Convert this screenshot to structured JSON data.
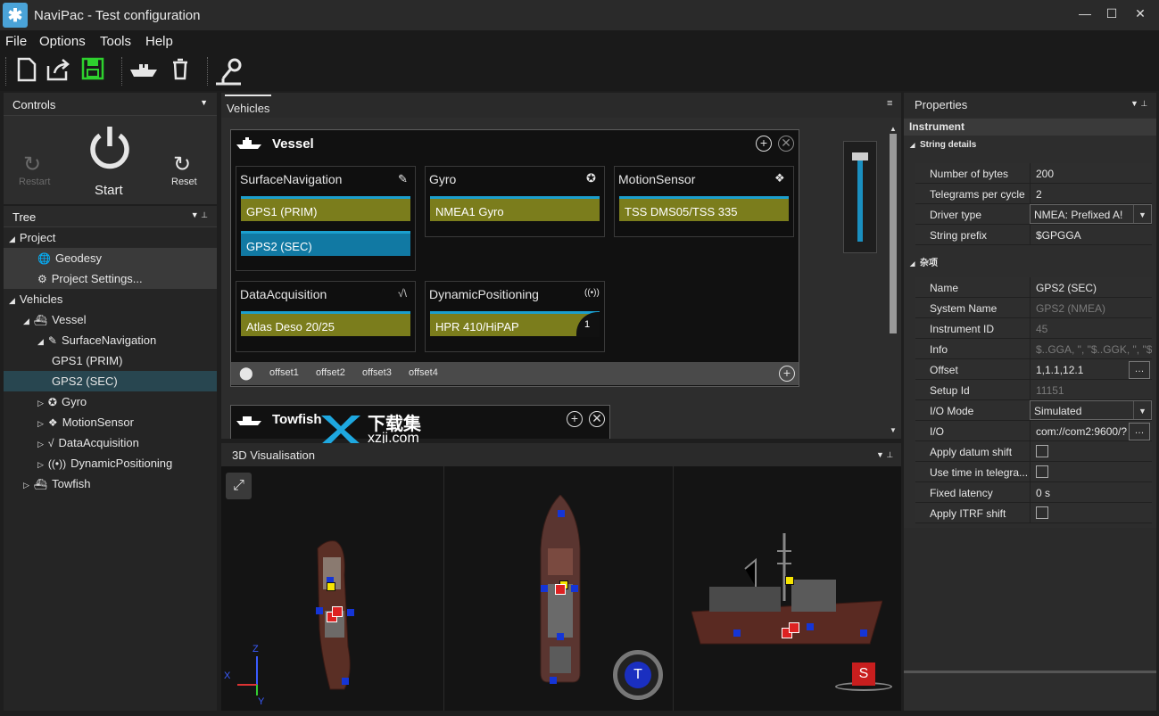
{
  "window": {
    "title": "NaviPac - Test configuration",
    "minimize": "—",
    "maximize": "☐",
    "close": "✕"
  },
  "menu": [
    "File",
    "Options",
    "Tools",
    "Help"
  ],
  "toolbar": {
    "icons": [
      "new-file-icon",
      "open-file-icon",
      "save-icon",
      "add-vehicle-icon",
      "delete-icon",
      "probe-icon"
    ]
  },
  "controls": {
    "header": "Controls",
    "restart": "Restart",
    "start": "Start",
    "reset": "Reset"
  },
  "tree": {
    "header": "Tree",
    "items": [
      {
        "label": "Project",
        "indent": 0,
        "arrow": "◢"
      },
      {
        "label": "Geodesy",
        "indent": 2,
        "icon": "🌐"
      },
      {
        "label": "Project Settings...",
        "indent": 2,
        "icon": "⚙"
      },
      {
        "label": "Vehicles",
        "indent": 0,
        "arrow": "◢"
      },
      {
        "label": "Vessel",
        "indent": 1,
        "arrow": "◢",
        "icon": "⛴"
      },
      {
        "label": "SurfaceNavigation",
        "indent": 2,
        "arrow": "◢",
        "icon": "✎"
      },
      {
        "label": "GPS1 (PRIM)",
        "indent": 3
      },
      {
        "label": "GPS2 (SEC)",
        "indent": 3
      },
      {
        "label": "Gyro",
        "indent": 2,
        "arrow": "▷",
        "icon": "✪"
      },
      {
        "label": "MotionSensor",
        "indent": 2,
        "arrow": "▷",
        "icon": "❖"
      },
      {
        "label": "DataAcquisition",
        "indent": 2,
        "arrow": "▷",
        "icon": "√"
      },
      {
        "label": "DynamicPositioning",
        "indent": 2,
        "arrow": "▷",
        "icon": "((•))"
      },
      {
        "label": "Towfish",
        "indent": 1,
        "arrow": "▷",
        "icon": "⛴"
      }
    ]
  },
  "vehicles": {
    "tab": "Vehicles",
    "vessel": {
      "name": "Vessel",
      "groups": [
        {
          "name": "SurfaceNavigation",
          "icon": "✎",
          "instruments": [
            {
              "label": "GPS1 (PRIM)",
              "color": "olive"
            },
            {
              "label": "GPS2 (SEC)",
              "color": "blue"
            }
          ]
        },
        {
          "name": "Gyro",
          "icon": "✪",
          "instruments": [
            {
              "label": "NMEA1 Gyro",
              "color": "olive"
            }
          ]
        },
        {
          "name": "MotionSensor",
          "icon": "❖",
          "instruments": [
            {
              "label": "TSS DMS05/TSS 335",
              "color": "olive"
            }
          ]
        },
        {
          "name": "DataAcquisition",
          "icon": "√",
          "instruments": [
            {
              "label": "Atlas Deso 20/25",
              "color": "olive"
            }
          ]
        },
        {
          "name": "DynamicPositioning",
          "icon": "((•))",
          "instruments": [
            {
              "label": "HPR 410/HiPAP",
              "color": "olive",
              "badge": "1"
            }
          ]
        }
      ],
      "offsets": [
        "offset1",
        "offset2",
        "offset3",
        "offset4"
      ]
    },
    "towfish": {
      "name": "Towfish"
    }
  },
  "watermark": {
    "cn": "下载集",
    "url": "xzji.com"
  },
  "viz": {
    "header": "3D Visualisation",
    "axes": {
      "z": "Z",
      "x": "X",
      "y": "Y"
    },
    "t": "T",
    "s": "S"
  },
  "properties": {
    "header": "Properties",
    "section": "Instrument",
    "sub1": "String details",
    "sub2": "杂项",
    "string_details": [
      {
        "name": "Number of bytes",
        "value": "200"
      },
      {
        "name": "Telegrams per cycle",
        "value": "2"
      },
      {
        "name": "Driver type",
        "value": "NMEA:   Prefixed A!",
        "type": "dropdown"
      },
      {
        "name": "String prefix",
        "value": "$GPGGA"
      }
    ],
    "misc": [
      {
        "name": "Name",
        "value": "GPS2 (SEC)"
      },
      {
        "name": "System Name",
        "value": "GPS2 (NMEA)",
        "dim": true
      },
      {
        "name": "Instrument ID",
        "value": "45",
        "dim": true
      },
      {
        "name": "Info",
        "value": "$..GGA, \", \"$..GGK, \", \"$...",
        "dim": true
      },
      {
        "name": "Offset",
        "value": "1,1.1,12.1",
        "type": "dots"
      },
      {
        "name": "Setup Id",
        "value": "11151",
        "dim": true
      },
      {
        "name": "I/O Mode",
        "value": "Simulated",
        "type": "dropdown"
      },
      {
        "name": "I/O",
        "value": " com://com2:9600/?",
        "type": "dots"
      },
      {
        "name": "Apply datum shift",
        "value": "",
        "type": "check"
      },
      {
        "name": "Use time in telegra...",
        "value": "",
        "type": "check"
      },
      {
        "name": "Fixed latency",
        "value": "0 s"
      },
      {
        "name": "Apply ITRF shift",
        "value": "",
        "type": "check"
      }
    ]
  }
}
